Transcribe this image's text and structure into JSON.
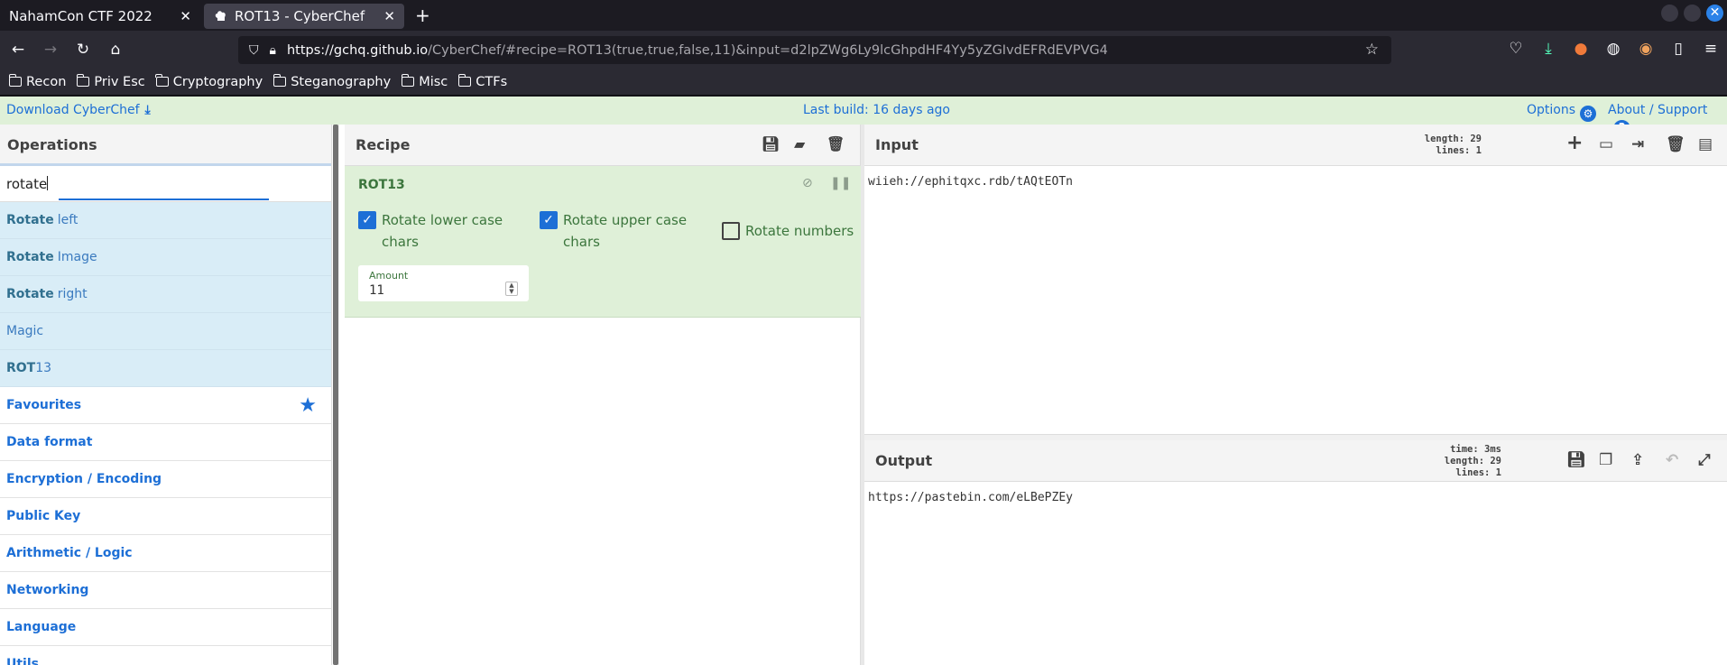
{
  "browser": {
    "tabs": [
      {
        "title": "NahamCon CTF 2022",
        "active": false
      },
      {
        "title": "ROT13 - CyberChef",
        "active": true
      }
    ],
    "url_host": "https://gchq.github.io",
    "url_rest": "/CyberChef/#recipe=ROT13(true,true,false,11)&input=d2lpZWg6Ly9lcGhpdHF4Yy5yZGIvdEFRdEVPVG4",
    "bookmarks": [
      "Recon",
      "Priv Esc",
      "Cryptography",
      "Steganography",
      "Misc",
      "CTFs"
    ]
  },
  "banner": {
    "download": "Download CyberChef",
    "build": "Last build: 16 days ago",
    "options": "Options",
    "about": "About / Support"
  },
  "operations": {
    "title": "Operations",
    "search": "rotate",
    "results": [
      {
        "match": "Rotate",
        "rest": "left"
      },
      {
        "match": "Rotate",
        "rest": "Image"
      },
      {
        "match": "Rotate",
        "rest": "right"
      },
      {
        "match": "",
        "rest": "Magic"
      },
      {
        "match": "ROT",
        "rest": "13"
      }
    ],
    "categories": [
      "Favourites",
      "Data format",
      "Encryption / Encoding",
      "Public Key",
      "Arithmetic / Logic",
      "Networking",
      "Language",
      "Utils"
    ]
  },
  "recipe": {
    "title": "Recipe",
    "ingredient": {
      "name": "ROT13",
      "lower_label": "Rotate lower case chars",
      "lower_checked": true,
      "upper_label": "Rotate upper case chars",
      "upper_checked": true,
      "numbers_label": "Rotate numbers",
      "numbers_checked": false,
      "amount_label": "Amount",
      "amount_value": "11"
    }
  },
  "input": {
    "title": "Input",
    "length_line": "length: 29",
    "lines_line": "lines:  1",
    "text": "wiieh://ephitqxc.rdb/tAQtEOTn"
  },
  "output": {
    "title": "Output",
    "time_line": "time:  3ms",
    "length_line": "length:  29",
    "lines_line": "lines:   1",
    "text": "https://pastebin.com/eLBePZEy"
  },
  "colors": {
    "accent": "#1d6fd6",
    "ingredient_bg": "#dff0d8",
    "ingredient_text": "#3c763d",
    "search_match_bg": "#d9edf7"
  }
}
